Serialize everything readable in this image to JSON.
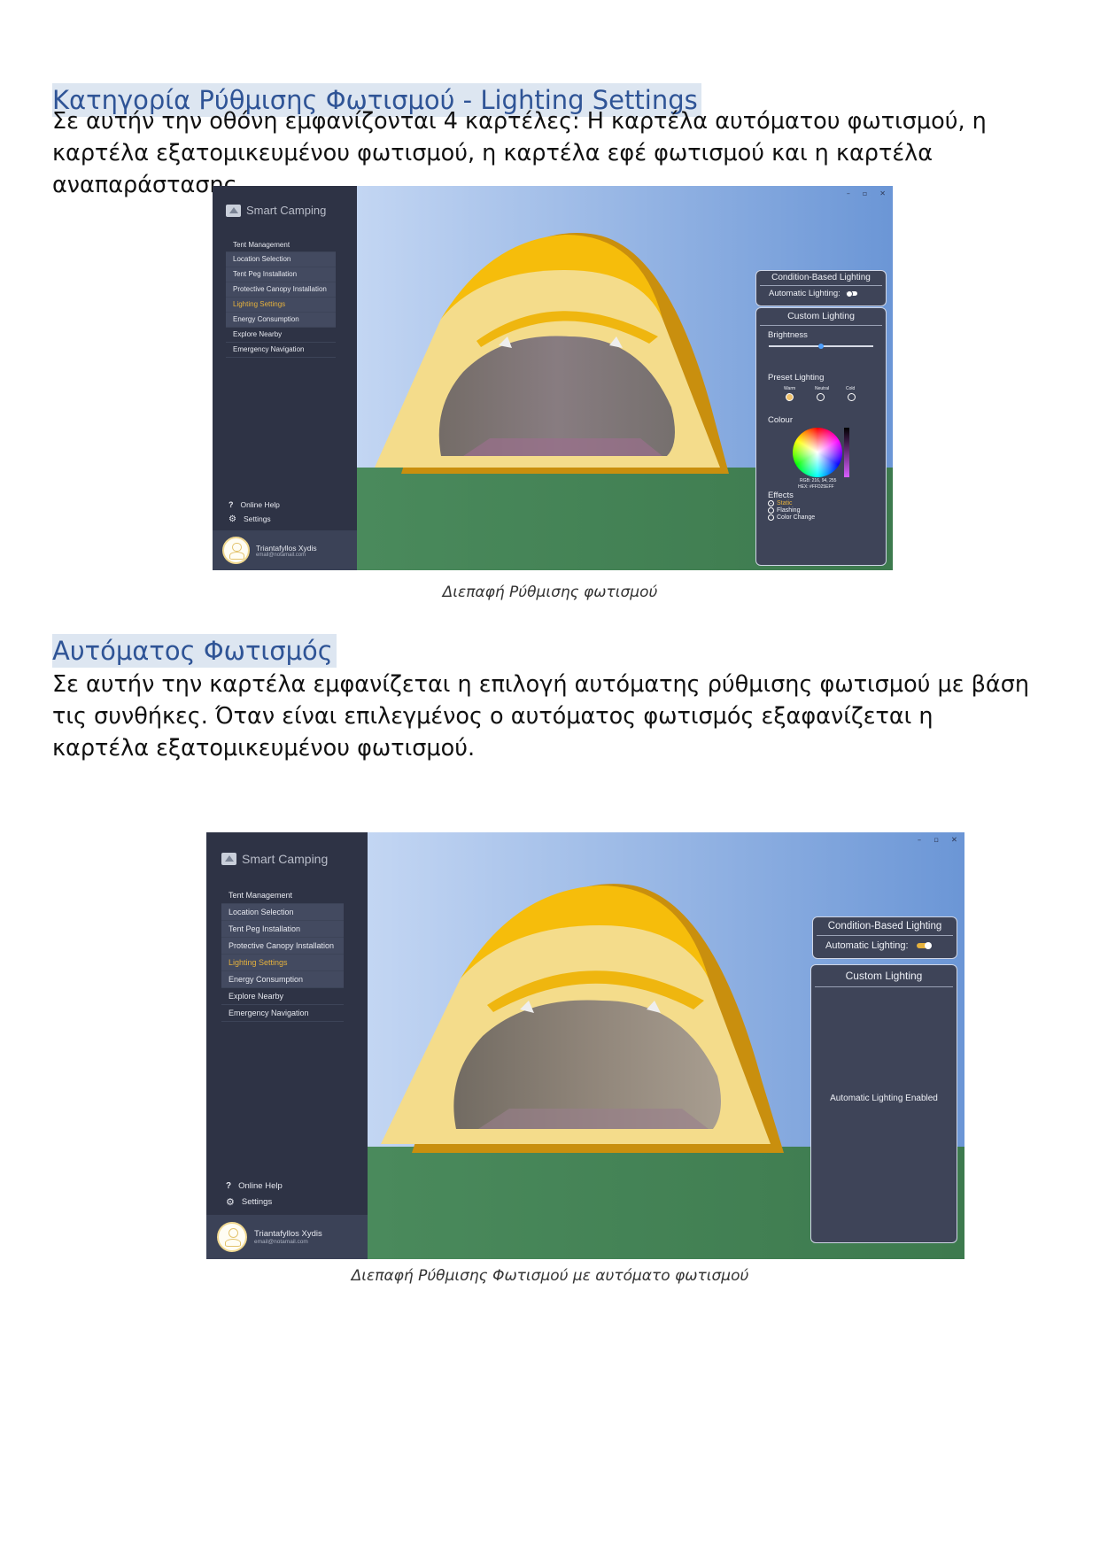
{
  "heading1": "Κατηγορία Ρύθμισης Φωτισμού - Lighting Settings",
  "para1": " Σε αυτήν την οθόνη εμφανίζονται 4 καρτέλες: Η καρτέλα αυτόματου φωτισμού, η καρτέλα εξατομικευμένου φωτισμού, η καρτέλα εφέ φωτισμού και η καρτέλα αναπαράστασης.",
  "caption1": "Διεπαφή Ρύθμισης φωτισμού",
  "heading2": "Αυτόματος Φωτισμός",
  "para2": "Σε αυτήν την καρτέλα εμφανίζεται η επιλογή αυτόματης ρύθμισης φωτισμού με βάση τις συνθήκες. Όταν είναι επιλεγμένος ο αυτόματος φωτισμός εξαφανίζεται η καρτέλα εξατομικευμένου φωτισμού.",
  "caption2": "Διεπαφή Ρύθμισης Φωτισμού με αυτόματο φωτισμού",
  "app": {
    "brand": "Smart Camping",
    "menu": {
      "tent_management": "Tent Management",
      "sub": [
        "Location Selection",
        "Tent Peg Installation",
        "Protective Canopy Installation",
        "Lighting Settings",
        "Energy Consumption"
      ],
      "explore": "Explore Nearby",
      "emergency": "Emergency Navigation"
    },
    "help": "Online Help",
    "settings": "Settings",
    "user_name": "Triantafyllos Xydis",
    "user_email": "email@notamail.com",
    "window_controls": [
      "–",
      "▫",
      "✕"
    ],
    "condition_title": "Condition-Based Lighting",
    "auto_label": "Automatic Lighting:",
    "custom_title": "Custom Lighting",
    "brightness": "Brightness",
    "brightness_level": 0.5,
    "preset": "Preset Lighting",
    "presets": [
      "Warm",
      "Neutral",
      "Cold"
    ],
    "colour": "Colour",
    "rgb": "RGB: 216, 94, 255",
    "hex": "HEX: #FFD25EFF",
    "effects": "Effects",
    "effect_options": [
      "Static",
      "Flashing",
      "Color Change"
    ],
    "auto_enabled": "Automatic Lighting Enabled",
    "colors": {
      "accent": "#e5b13d",
      "sidebar": "#2e3345",
      "panel": "#3e4458",
      "toggle_on": "#e5b13d",
      "toggle_off": "#ffffff"
    }
  }
}
